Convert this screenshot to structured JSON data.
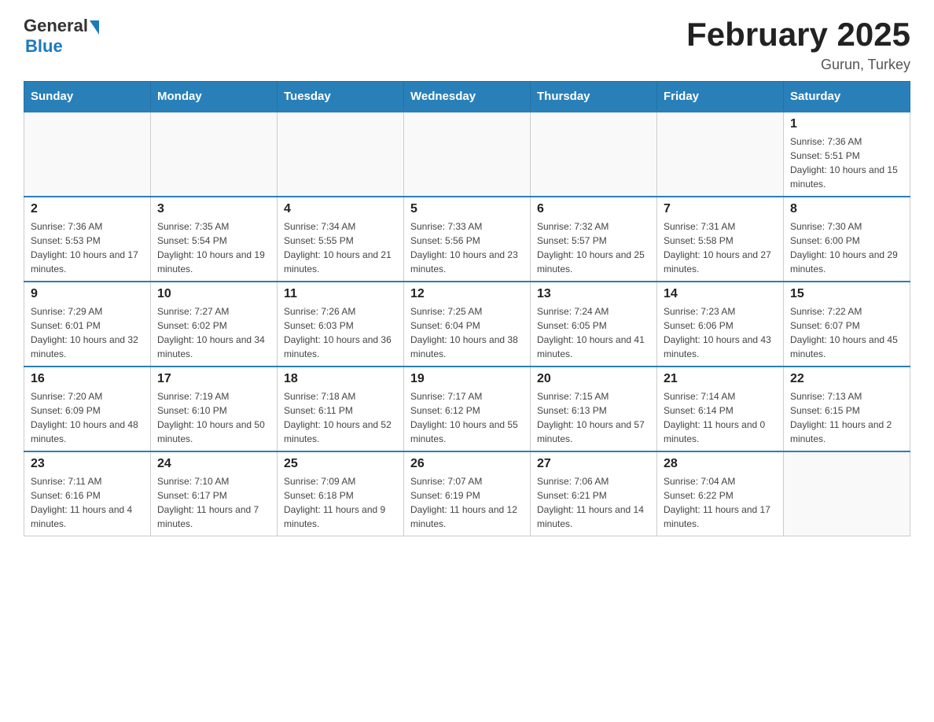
{
  "header": {
    "logo_general": "General",
    "logo_blue": "Blue",
    "month_title": "February 2025",
    "location": "Gurun, Turkey"
  },
  "days_of_week": [
    "Sunday",
    "Monday",
    "Tuesday",
    "Wednesday",
    "Thursday",
    "Friday",
    "Saturday"
  ],
  "weeks": [
    [
      {
        "day": "",
        "info": ""
      },
      {
        "day": "",
        "info": ""
      },
      {
        "day": "",
        "info": ""
      },
      {
        "day": "",
        "info": ""
      },
      {
        "day": "",
        "info": ""
      },
      {
        "day": "",
        "info": ""
      },
      {
        "day": "1",
        "info": "Sunrise: 7:36 AM\nSunset: 5:51 PM\nDaylight: 10 hours and 15 minutes."
      }
    ],
    [
      {
        "day": "2",
        "info": "Sunrise: 7:36 AM\nSunset: 5:53 PM\nDaylight: 10 hours and 17 minutes."
      },
      {
        "day": "3",
        "info": "Sunrise: 7:35 AM\nSunset: 5:54 PM\nDaylight: 10 hours and 19 minutes."
      },
      {
        "day": "4",
        "info": "Sunrise: 7:34 AM\nSunset: 5:55 PM\nDaylight: 10 hours and 21 minutes."
      },
      {
        "day": "5",
        "info": "Sunrise: 7:33 AM\nSunset: 5:56 PM\nDaylight: 10 hours and 23 minutes."
      },
      {
        "day": "6",
        "info": "Sunrise: 7:32 AM\nSunset: 5:57 PM\nDaylight: 10 hours and 25 minutes."
      },
      {
        "day": "7",
        "info": "Sunrise: 7:31 AM\nSunset: 5:58 PM\nDaylight: 10 hours and 27 minutes."
      },
      {
        "day": "8",
        "info": "Sunrise: 7:30 AM\nSunset: 6:00 PM\nDaylight: 10 hours and 29 minutes."
      }
    ],
    [
      {
        "day": "9",
        "info": "Sunrise: 7:29 AM\nSunset: 6:01 PM\nDaylight: 10 hours and 32 minutes."
      },
      {
        "day": "10",
        "info": "Sunrise: 7:27 AM\nSunset: 6:02 PM\nDaylight: 10 hours and 34 minutes."
      },
      {
        "day": "11",
        "info": "Sunrise: 7:26 AM\nSunset: 6:03 PM\nDaylight: 10 hours and 36 minutes."
      },
      {
        "day": "12",
        "info": "Sunrise: 7:25 AM\nSunset: 6:04 PM\nDaylight: 10 hours and 38 minutes."
      },
      {
        "day": "13",
        "info": "Sunrise: 7:24 AM\nSunset: 6:05 PM\nDaylight: 10 hours and 41 minutes."
      },
      {
        "day": "14",
        "info": "Sunrise: 7:23 AM\nSunset: 6:06 PM\nDaylight: 10 hours and 43 minutes."
      },
      {
        "day": "15",
        "info": "Sunrise: 7:22 AM\nSunset: 6:07 PM\nDaylight: 10 hours and 45 minutes."
      }
    ],
    [
      {
        "day": "16",
        "info": "Sunrise: 7:20 AM\nSunset: 6:09 PM\nDaylight: 10 hours and 48 minutes."
      },
      {
        "day": "17",
        "info": "Sunrise: 7:19 AM\nSunset: 6:10 PM\nDaylight: 10 hours and 50 minutes."
      },
      {
        "day": "18",
        "info": "Sunrise: 7:18 AM\nSunset: 6:11 PM\nDaylight: 10 hours and 52 minutes."
      },
      {
        "day": "19",
        "info": "Sunrise: 7:17 AM\nSunset: 6:12 PM\nDaylight: 10 hours and 55 minutes."
      },
      {
        "day": "20",
        "info": "Sunrise: 7:15 AM\nSunset: 6:13 PM\nDaylight: 10 hours and 57 minutes."
      },
      {
        "day": "21",
        "info": "Sunrise: 7:14 AM\nSunset: 6:14 PM\nDaylight: 11 hours and 0 minutes."
      },
      {
        "day": "22",
        "info": "Sunrise: 7:13 AM\nSunset: 6:15 PM\nDaylight: 11 hours and 2 minutes."
      }
    ],
    [
      {
        "day": "23",
        "info": "Sunrise: 7:11 AM\nSunset: 6:16 PM\nDaylight: 11 hours and 4 minutes."
      },
      {
        "day": "24",
        "info": "Sunrise: 7:10 AM\nSunset: 6:17 PM\nDaylight: 11 hours and 7 minutes."
      },
      {
        "day": "25",
        "info": "Sunrise: 7:09 AM\nSunset: 6:18 PM\nDaylight: 11 hours and 9 minutes."
      },
      {
        "day": "26",
        "info": "Sunrise: 7:07 AM\nSunset: 6:19 PM\nDaylight: 11 hours and 12 minutes."
      },
      {
        "day": "27",
        "info": "Sunrise: 7:06 AM\nSunset: 6:21 PM\nDaylight: 11 hours and 14 minutes."
      },
      {
        "day": "28",
        "info": "Sunrise: 7:04 AM\nSunset: 6:22 PM\nDaylight: 11 hours and 17 minutes."
      },
      {
        "day": "",
        "info": ""
      }
    ]
  ]
}
